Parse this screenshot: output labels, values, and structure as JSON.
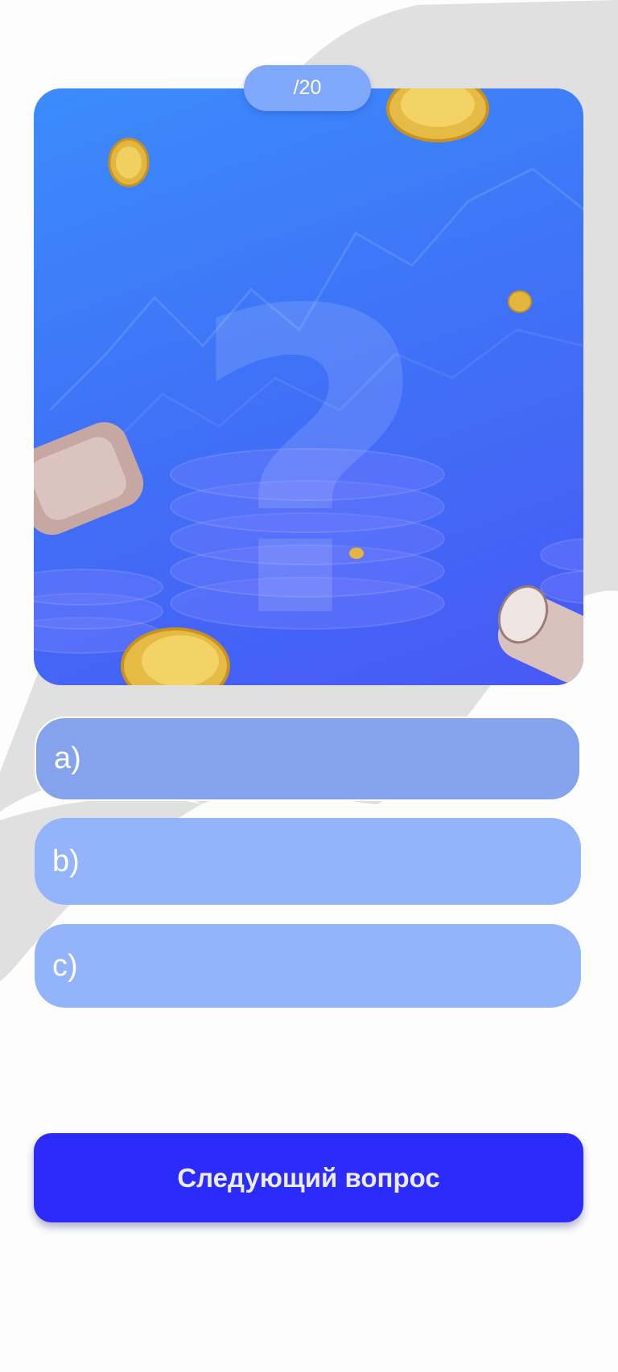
{
  "quiz": {
    "counter": "/20",
    "answers": [
      {
        "letter": "a)",
        "selected": true
      },
      {
        "letter": "b)",
        "selected": false
      },
      {
        "letter": "c)",
        "selected": false
      }
    ],
    "next_button_label": "Следующий вопрос",
    "hero_icon": "question-mark-coins-illustration"
  },
  "colors": {
    "background": "#fdfdfd",
    "swoosh": "#e0e0e0",
    "card_gradient_top": "#3b8cfb",
    "card_gradient_bottom": "#4859f5",
    "counter_pill": "#7fa8fb",
    "answer": "#93b3fb",
    "answer_selected": "#84a3ec",
    "next_button": "#2b2bfb"
  }
}
